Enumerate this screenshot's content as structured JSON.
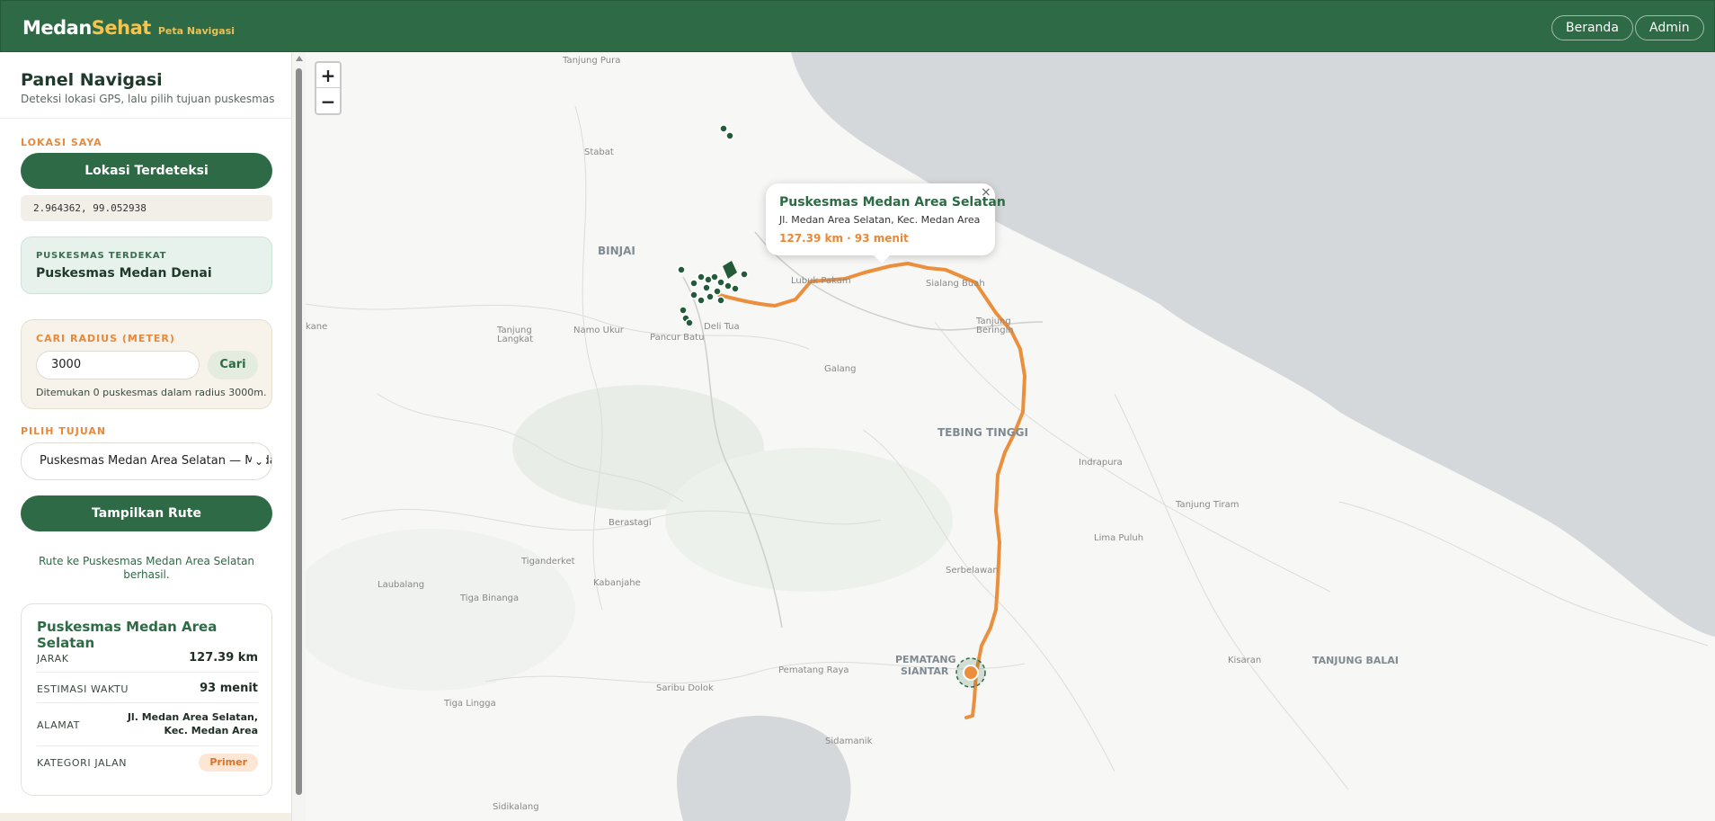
{
  "app": {
    "brand_main": "Medan",
    "brand_accent": "Sehat",
    "brand_sub": "Peta Navigasi",
    "nav": [
      "Beranda",
      "Admin"
    ]
  },
  "panel": {
    "title": "Panel Navigasi",
    "subtitle": "Deteksi lokasi GPS, lalu pilih tujuan puskesmas",
    "location_label": "LOKASI SAYA",
    "location_button": "Lokasi Terdeteksi",
    "coordinates": "2.964362, 99.052938",
    "nearest_label": "PUSKESMAS TERDEKAT",
    "nearest_name": "Puskesmas Medan Denai",
    "radius_label": "CARI RADIUS (METER)",
    "radius_value": "3000",
    "radius_button": "Cari",
    "radius_note": "Ditemukan 0 puskesmas dalam radius 3000m.",
    "destination_label": "PILIH TUJUAN",
    "destination_selected": "Puskesmas Medan Area Selatan — Medan Area",
    "route_button": "Tampilkan Rute",
    "route_message": "Rute ke Puskesmas Medan Area Selatan berhasil."
  },
  "result": {
    "name": "Puskesmas Medan Area Selatan",
    "rows": [
      {
        "key": "JARAK",
        "value": "127.39 km"
      },
      {
        "key": "ESTIMASI WAKTU",
        "value": "93 menit"
      },
      {
        "key": "ALAMAT",
        "value": "Jl. Medan Area Selatan, Kec. Medan Area"
      },
      {
        "key": "KATEGORI JALAN",
        "value": "Primer"
      }
    ]
  },
  "map": {
    "zoom_in": "+",
    "zoom_out": "−",
    "popup": {
      "close": "×",
      "title": "Puskesmas Medan Area Selatan",
      "address": "Jl. Medan Area Selatan, Kec. Medan Area",
      "meta": "127.39 km · 93 menit"
    },
    "places": {
      "tanjung_pura": "Tanjung Pura",
      "stabat": "Stabat",
      "binjai": "BINJAI",
      "lubuk_pakam": "Lubuk Pakam",
      "sialang_buah": "Sialang Buah",
      "tanjung_beringin_a": "Tanjung",
      "tanjung_beringin_b": "Beringin",
      "tanjung_langkat_a": "Tanjung",
      "tanjung_langkat_b": "Langkat",
      "namo_ukur": "Namo Ukur",
      "deli_tua": "Deli Tua",
      "pancur_batu": "Pancur Batu",
      "kane": "kane",
      "galang": "Galang",
      "tebing_tinggi": "TEBING TINGGI",
      "indrapura": "Indrapura",
      "tanjung_tiram": "Tanjung Tiram",
      "lima_puluh": "Lima Puluh",
      "berastagi": "Berastagi",
      "tiganderket": "Tiganderket",
      "kabanjahe": "Kabanjahe",
      "laubalang": "Laubalang",
      "tiga_binanga": "Tiga Binanga",
      "serbelawan": "Serbelawan",
      "pematang_raya": "Pematang Raya",
      "pematang_siantar_a": "PEMATANG",
      "pematang_siantar_b": "SIANTAR",
      "kisaran": "Kisaran",
      "tanjung_balai": "TANJUNG BALAI",
      "tiga_lingga": "Tiga Lingga",
      "saribu_dolok": "Saribu Dolok",
      "sidamanik": "Sidamanik",
      "sidikalang": "Sidikalang"
    },
    "colors": {
      "route": "#ec8f3d",
      "marker": "#235a3a",
      "sea": "#d5d8da",
      "land": "#f7f7f5",
      "forest": "#e4e9e3"
    }
  }
}
